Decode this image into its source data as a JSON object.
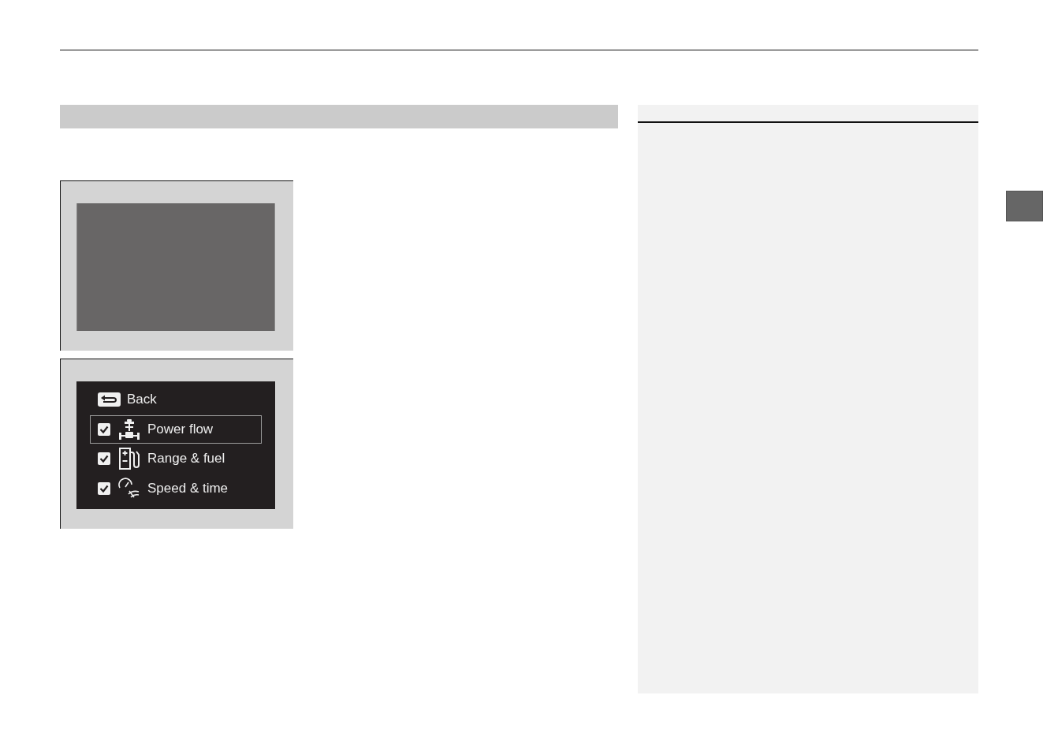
{
  "screens": [
    {
      "kind": "blank"
    },
    {
      "kind": "menu",
      "back_label": "Back",
      "items": [
        {
          "label": "Power flow",
          "checked": true,
          "selected": true
        },
        {
          "label": "Range & fuel",
          "checked": true,
          "selected": false
        },
        {
          "label": "Speed & time",
          "checked": true,
          "selected": false
        }
      ]
    }
  ]
}
